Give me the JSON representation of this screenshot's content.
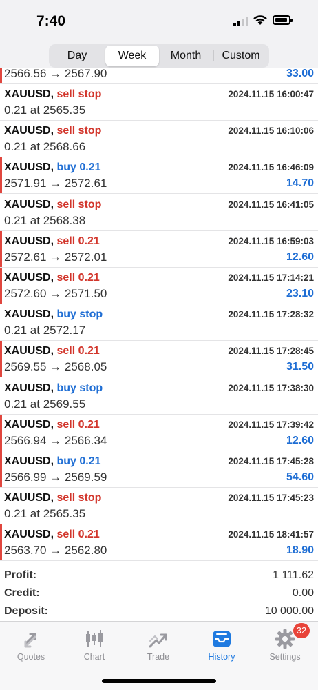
{
  "status_bar": {
    "time": "7:40"
  },
  "period_tabs": {
    "items": [
      "Day",
      "Week",
      "Month",
      "Custom"
    ],
    "selected": "Week"
  },
  "partial_row": {
    "detail": "2566.56 → 2567.90",
    "profit": "33.00"
  },
  "deals": [
    {
      "symbol": "XAUUSD,",
      "action": "sell stop",
      "side": "sell",
      "time": "2024.11.15 16:00:47",
      "detail": "0.21 at 2565.35",
      "profit": ""
    },
    {
      "symbol": "XAUUSD,",
      "action": "sell stop",
      "side": "sell",
      "time": "2024.11.15 16:10:06",
      "detail": "0.21 at 2568.66",
      "profit": ""
    },
    {
      "symbol": "XAUUSD,",
      "action": "buy 0.21",
      "side": "buy",
      "time": "2024.11.15 16:46:09",
      "detail": "2571.91 → 2572.61",
      "profit": "14.70"
    },
    {
      "symbol": "XAUUSD,",
      "action": "sell stop",
      "side": "sell",
      "time": "2024.11.15 16:41:05",
      "detail": "0.21 at 2568.38",
      "profit": ""
    },
    {
      "symbol": "XAUUSD,",
      "action": "sell 0.21",
      "side": "sell",
      "time": "2024.11.15 16:59:03",
      "detail": "2572.61 → 2572.01",
      "profit": "12.60"
    },
    {
      "symbol": "XAUUSD,",
      "action": "sell 0.21",
      "side": "sell",
      "time": "2024.11.15 17:14:21",
      "detail": "2572.60 → 2571.50",
      "profit": "23.10"
    },
    {
      "symbol": "XAUUSD,",
      "action": "buy stop",
      "side": "buy",
      "time": "2024.11.15 17:28:32",
      "detail": "0.21 at 2572.17",
      "profit": ""
    },
    {
      "symbol": "XAUUSD,",
      "action": "sell 0.21",
      "side": "sell",
      "time": "2024.11.15 17:28:45",
      "detail": "2569.55 → 2568.05",
      "profit": "31.50"
    },
    {
      "symbol": "XAUUSD,",
      "action": "buy stop",
      "side": "buy",
      "time": "2024.11.15 17:38:30",
      "detail": "0.21 at 2569.55",
      "profit": ""
    },
    {
      "symbol": "XAUUSD,",
      "action": "sell 0.21",
      "side": "sell",
      "time": "2024.11.15 17:39:42",
      "detail": "2566.94 → 2566.34",
      "profit": "12.60"
    },
    {
      "symbol": "XAUUSD,",
      "action": "buy 0.21",
      "side": "buy",
      "time": "2024.11.15 17:45:28",
      "detail": "2566.99 → 2569.59",
      "profit": "54.60"
    },
    {
      "symbol": "XAUUSD,",
      "action": "sell stop",
      "side": "sell",
      "time": "2024.11.15 17:45:23",
      "detail": "0.21 at 2565.35",
      "profit": ""
    },
    {
      "symbol": "XAUUSD,",
      "action": "sell 0.21",
      "side": "sell",
      "time": "2024.11.15 18:41:57",
      "detail": "2563.70 → 2562.80",
      "profit": "18.90"
    }
  ],
  "summary": {
    "profit_label": "Profit:",
    "profit_value": "1 111.62",
    "credit_label": "Credit:",
    "credit_value": "0.00",
    "deposit_label": "Deposit:",
    "deposit_value": "10 000.00"
  },
  "tab_bar": {
    "items": [
      {
        "label": "Quotes",
        "icon": "quotes-arrows-icon"
      },
      {
        "label": "Chart",
        "icon": "candlestick-icon"
      },
      {
        "label": "Trade",
        "icon": "trade-trend-icon"
      },
      {
        "label": "History",
        "icon": "history-inbox-icon"
      },
      {
        "label": "Settings",
        "icon": "gear-icon"
      }
    ],
    "selected": "History",
    "settings_badge": "32"
  },
  "colors": {
    "sell": "#d2352b",
    "buy": "#1f6ed4",
    "profit": "#1f6ed4",
    "active_tab": "#1f7ae0",
    "inactive_tab": "#8e8e93",
    "marker": "#e0463e",
    "badge": "#e8443a"
  }
}
